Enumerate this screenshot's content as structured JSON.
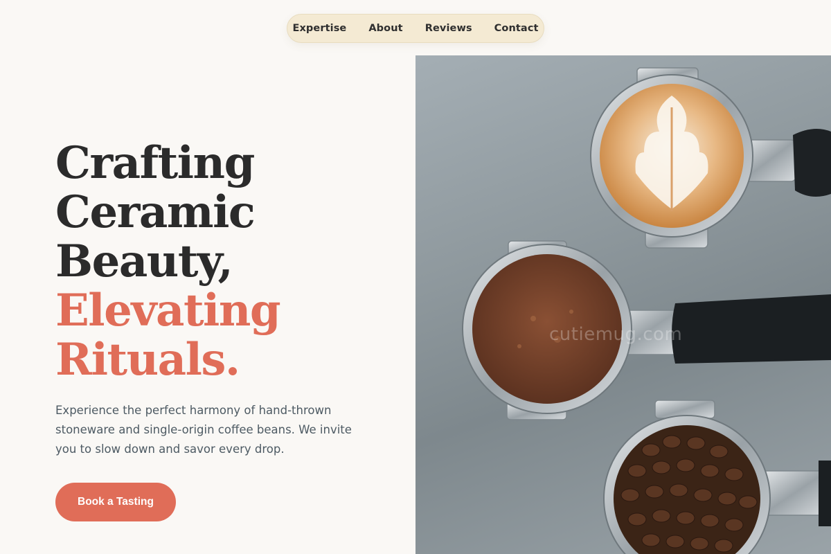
{
  "nav": {
    "items": [
      "Expertise",
      "About",
      "Reviews",
      "Contact"
    ]
  },
  "hero": {
    "headline_dark": [
      "Crafting",
      "Ceramic",
      "Beauty,"
    ],
    "headline_accent": [
      "Elevating",
      "Rituals."
    ],
    "description": "Experience the perfect harmony of hand-thrown stoneware and single-origin coffee beans. We invite you to slow down and savor every drop.",
    "cta_label": "Book a Tasting"
  },
  "photo": {
    "watermark": "cutiemug.com"
  },
  "colors": {
    "accent": "#e06d58",
    "nav_bg": "#f4ead3",
    "page_bg": "#faf8f5",
    "text_dark": "#2b2b2b"
  }
}
